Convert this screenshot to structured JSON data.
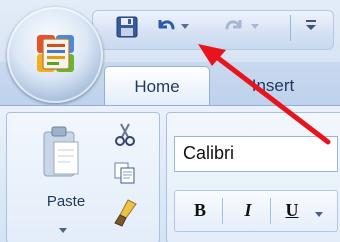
{
  "quick_access": {
    "icons": [
      "save-icon",
      "undo-icon",
      "undo-dropdown-icon",
      "redo-icon",
      "redo-dropdown-icon",
      "customize-qat-icon"
    ]
  },
  "office_button": {
    "icon": "office-logo-icon"
  },
  "tabs": [
    {
      "label": "Home",
      "selected": true
    },
    {
      "label": "Insert",
      "selected": false
    }
  ],
  "clipboard": {
    "paste_label": "Paste",
    "icons": [
      "paste-icon",
      "cut-icon",
      "copy-icon",
      "format-painter-icon"
    ]
  },
  "font": {
    "name": "Calibri",
    "bold_label": "B",
    "italic_label": "I",
    "underline_label": "U"
  },
  "annotation": {
    "arrow_color": "#e8141c"
  },
  "colors": {
    "ribbon_bg": "#dfe9f7",
    "tab_text": "#1e395b",
    "border": "#8fb0db"
  }
}
